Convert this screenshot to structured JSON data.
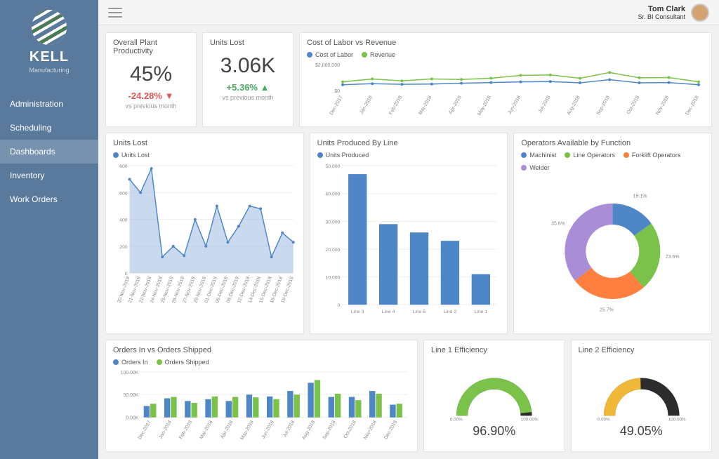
{
  "brand": {
    "name": "KELL",
    "sub": "Manufacturing"
  },
  "user": {
    "name": "Tom Clark",
    "role": "Sr. BI Consultant"
  },
  "nav": {
    "items": [
      {
        "label": "Administration"
      },
      {
        "label": "Scheduling"
      },
      {
        "label": "Dashboards",
        "active": true
      },
      {
        "label": "Inventory"
      },
      {
        "label": "Work Orders"
      }
    ]
  },
  "kpis": {
    "productivity": {
      "title": "Overall Plant Productivity",
      "value": "45%",
      "delta": "-24.28% ▼",
      "sub": "vs previous month"
    },
    "units_lost": {
      "title": "Units Lost",
      "value": "3.06K",
      "delta": "+5.36% ▲",
      "sub": "vs previous month"
    }
  },
  "chart_data": {
    "cost_vs_revenue": {
      "type": "line",
      "title": "Cost of Labor vs Revenue",
      "y_scale_label": "$2,000,000",
      "y_zero_label": "$0",
      "categories": [
        "Dec-2017",
        "Jan-2018",
        "Feb-2018",
        "Mar-2018",
        "Apr-2018",
        "May-2018",
        "Jun-2018",
        "Jul-2018",
        "Aug-2018",
        "Sep-2018",
        "Oct-2018",
        "Nov-2018",
        "Dec-2018"
      ],
      "series": [
        {
          "name": "Cost of Labor",
          "color": "#4f86c7",
          "values": [
            550000,
            620000,
            580000,
            600000,
            650000,
            700000,
            750000,
            770000,
            680000,
            900000,
            680000,
            700000,
            550000
          ]
        },
        {
          "name": "Revenue",
          "color": "#7bc24a",
          "values": [
            750000,
            950000,
            820000,
            950000,
            920000,
            1000000,
            1200000,
            1230000,
            1000000,
            1400000,
            1030000,
            1050000,
            750000
          ]
        }
      ],
      "ylim": [
        0,
        2000000
      ]
    },
    "units_lost_trend": {
      "type": "area",
      "title": "Units Lost",
      "legend": "Units Lost",
      "color": "#4f86c7",
      "categories": [
        "20-Nov-2018",
        "21-Nov-2018",
        "22-Nov-2018",
        "24-Nov-2018",
        "25-Nov-2018",
        "26-Nov-2018",
        "27-Nov-2018",
        "29-Nov-2018",
        "01-Dec-2018",
        "06-Dec-2018",
        "08-Dec-2018",
        "12-Dec-2018",
        "14-Dec-2018",
        "15-Dec-2018",
        "16-Dec-2018",
        "19-Dec-2018"
      ],
      "values": [
        700,
        600,
        780,
        120,
        200,
        130,
        400,
        200,
        500,
        230,
        350,
        500,
        480,
        120,
        300,
        230
      ],
      "ylim": [
        0,
        800
      ],
      "yticks": [
        0,
        200,
        400,
        600,
        800
      ]
    },
    "units_by_line": {
      "type": "bar",
      "title": "Units Produced By Line",
      "legend": "Units Produced",
      "color": "#4f86c7",
      "categories": [
        "Line 3",
        "Line 4",
        "Line 5",
        "Line 2",
        "Line 1"
      ],
      "values": [
        47000,
        29000,
        26000,
        23000,
        11000
      ],
      "ylim": [
        0,
        50000
      ],
      "yticks": [
        0,
        10000,
        20000,
        30000,
        40000,
        50000
      ]
    },
    "operators_by_function": {
      "type": "pie",
      "title": "Operators Available by Function",
      "slices": [
        {
          "name": "Machinist",
          "value": 15.1,
          "label": "15.1%",
          "color": "#4f86c7"
        },
        {
          "name": "Line Operators",
          "value": 23.6,
          "label": "23.6%",
          "color": "#7bc24a"
        },
        {
          "name": "Forklift Operators",
          "value": 25.7,
          "label": "25.7%",
          "color": "#ff7f3f"
        },
        {
          "name": "Welder",
          "value": 35.6,
          "label": "35.6%",
          "color": "#a98dd6"
        }
      ]
    },
    "orders": {
      "type": "bar",
      "title": "Orders In vs Orders Shipped",
      "y_scale_top": "100.00K",
      "y_scale_mid": "50.00K",
      "y_scale_zero": "0.00K",
      "categories": [
        "Dec-2017",
        "Jan-2018",
        "Feb-2018",
        "Mar-2018",
        "Apr-2018",
        "May-2018",
        "Jun-2018",
        "Jul-2018",
        "Aug-2018",
        "Sep-2018",
        "Oct-2018",
        "Nov-2018",
        "Dec-2018"
      ],
      "series": [
        {
          "name": "Orders In",
          "color": "#4f86c7",
          "values": [
            25,
            42,
            36,
            40,
            36,
            50,
            46,
            58,
            76,
            45,
            45,
            58,
            28
          ]
        },
        {
          "name": "Orders Shipped",
          "color": "#7bc24a",
          "values": [
            30,
            45,
            32,
            46,
            45,
            44,
            40,
            50,
            82,
            52,
            38,
            52,
            30
          ]
        }
      ],
      "ylim": [
        0,
        100
      ]
    },
    "line1_eff": {
      "type": "gauge",
      "title": "Line 1 Efficiency",
      "value": 96.9,
      "display": "96.90%",
      "min_label": "0.00%",
      "max_label": "100.00%",
      "color": "#7bc24a"
    },
    "line2_eff": {
      "type": "gauge",
      "title": "Line 2 Efficiency",
      "value": 49.05,
      "display": "49.05%",
      "min_label": "0.00%",
      "max_label": "100.00%",
      "color": "#f0b838"
    }
  }
}
